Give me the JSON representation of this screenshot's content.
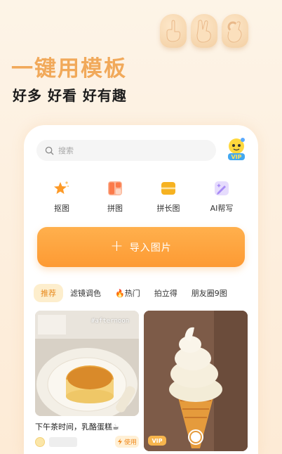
{
  "hero": {
    "title": "一键用模板",
    "subtitle": "好多 好看 好有趣"
  },
  "search": {
    "placeholder": "搜索"
  },
  "vip_badge": "VIP",
  "tools": [
    {
      "label": "抠图",
      "icon": "star-sparkle-icon",
      "color": "#fd9a28"
    },
    {
      "label": "拼图",
      "icon": "collage-grid-icon",
      "color": "#fb7a4a"
    },
    {
      "label": "拼长图",
      "icon": "long-image-icon",
      "color": "#f6b221"
    },
    {
      "label": "AI帮写",
      "icon": "ai-pen-icon",
      "color": "#a88bf5"
    }
  ],
  "import_button": {
    "label": "导入图片",
    "icon": "plus-icon"
  },
  "categories": [
    {
      "label": "推荐",
      "active": true
    },
    {
      "label": "滤镜调色",
      "active": false
    },
    {
      "label": "🔥热门",
      "active": false
    },
    {
      "label": "拍立得",
      "active": false
    },
    {
      "label": "朋友圈9图",
      "active": false
    }
  ],
  "templates": [
    {
      "title": "下午茶时间，乳酪蛋糕☕",
      "overlay": "#afternoon",
      "badge": "使用"
    },
    {
      "badge": "VIP"
    }
  ],
  "colors": {
    "accent": "#fd9a33",
    "hero_title": "#f1a95a"
  }
}
